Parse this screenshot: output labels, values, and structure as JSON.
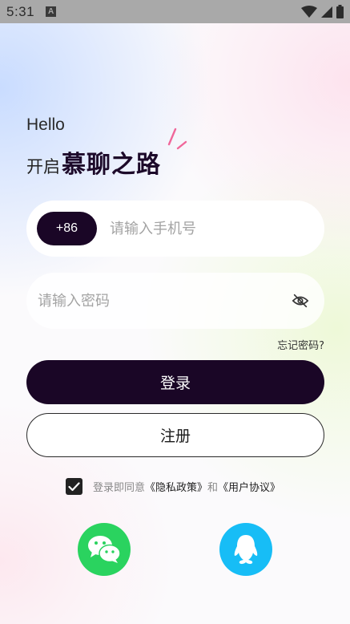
{
  "status_bar": {
    "time": "5:31",
    "notification_icon": "a-icon",
    "icons": [
      "wifi-icon",
      "signal-icon",
      "battery-icon"
    ]
  },
  "greeting": {
    "hello": "Hello",
    "prefix": "开启",
    "brand": "慕聊之路"
  },
  "phone": {
    "country_code": "+86",
    "placeholder": "请输入手机号"
  },
  "password": {
    "placeholder": "请输入密码",
    "toggle_icon": "eye-hidden-icon"
  },
  "forgot_label": "忘记密码?",
  "login_label": "登录",
  "register_label": "注册",
  "agreement": {
    "checked": true,
    "text_prefix": "登录即同意",
    "privacy_link": "《隐私政策》",
    "and": "和",
    "terms_link": "《用户协议》"
  },
  "social_login": [
    {
      "name": "wechat",
      "icon": "wechat-icon",
      "color": "#2ad35f"
    },
    {
      "name": "qq",
      "icon": "qq-icon",
      "color": "#17bdf6"
    }
  ],
  "colors": {
    "primary": "#1a0626",
    "accent_pink": "#f0679a"
  }
}
